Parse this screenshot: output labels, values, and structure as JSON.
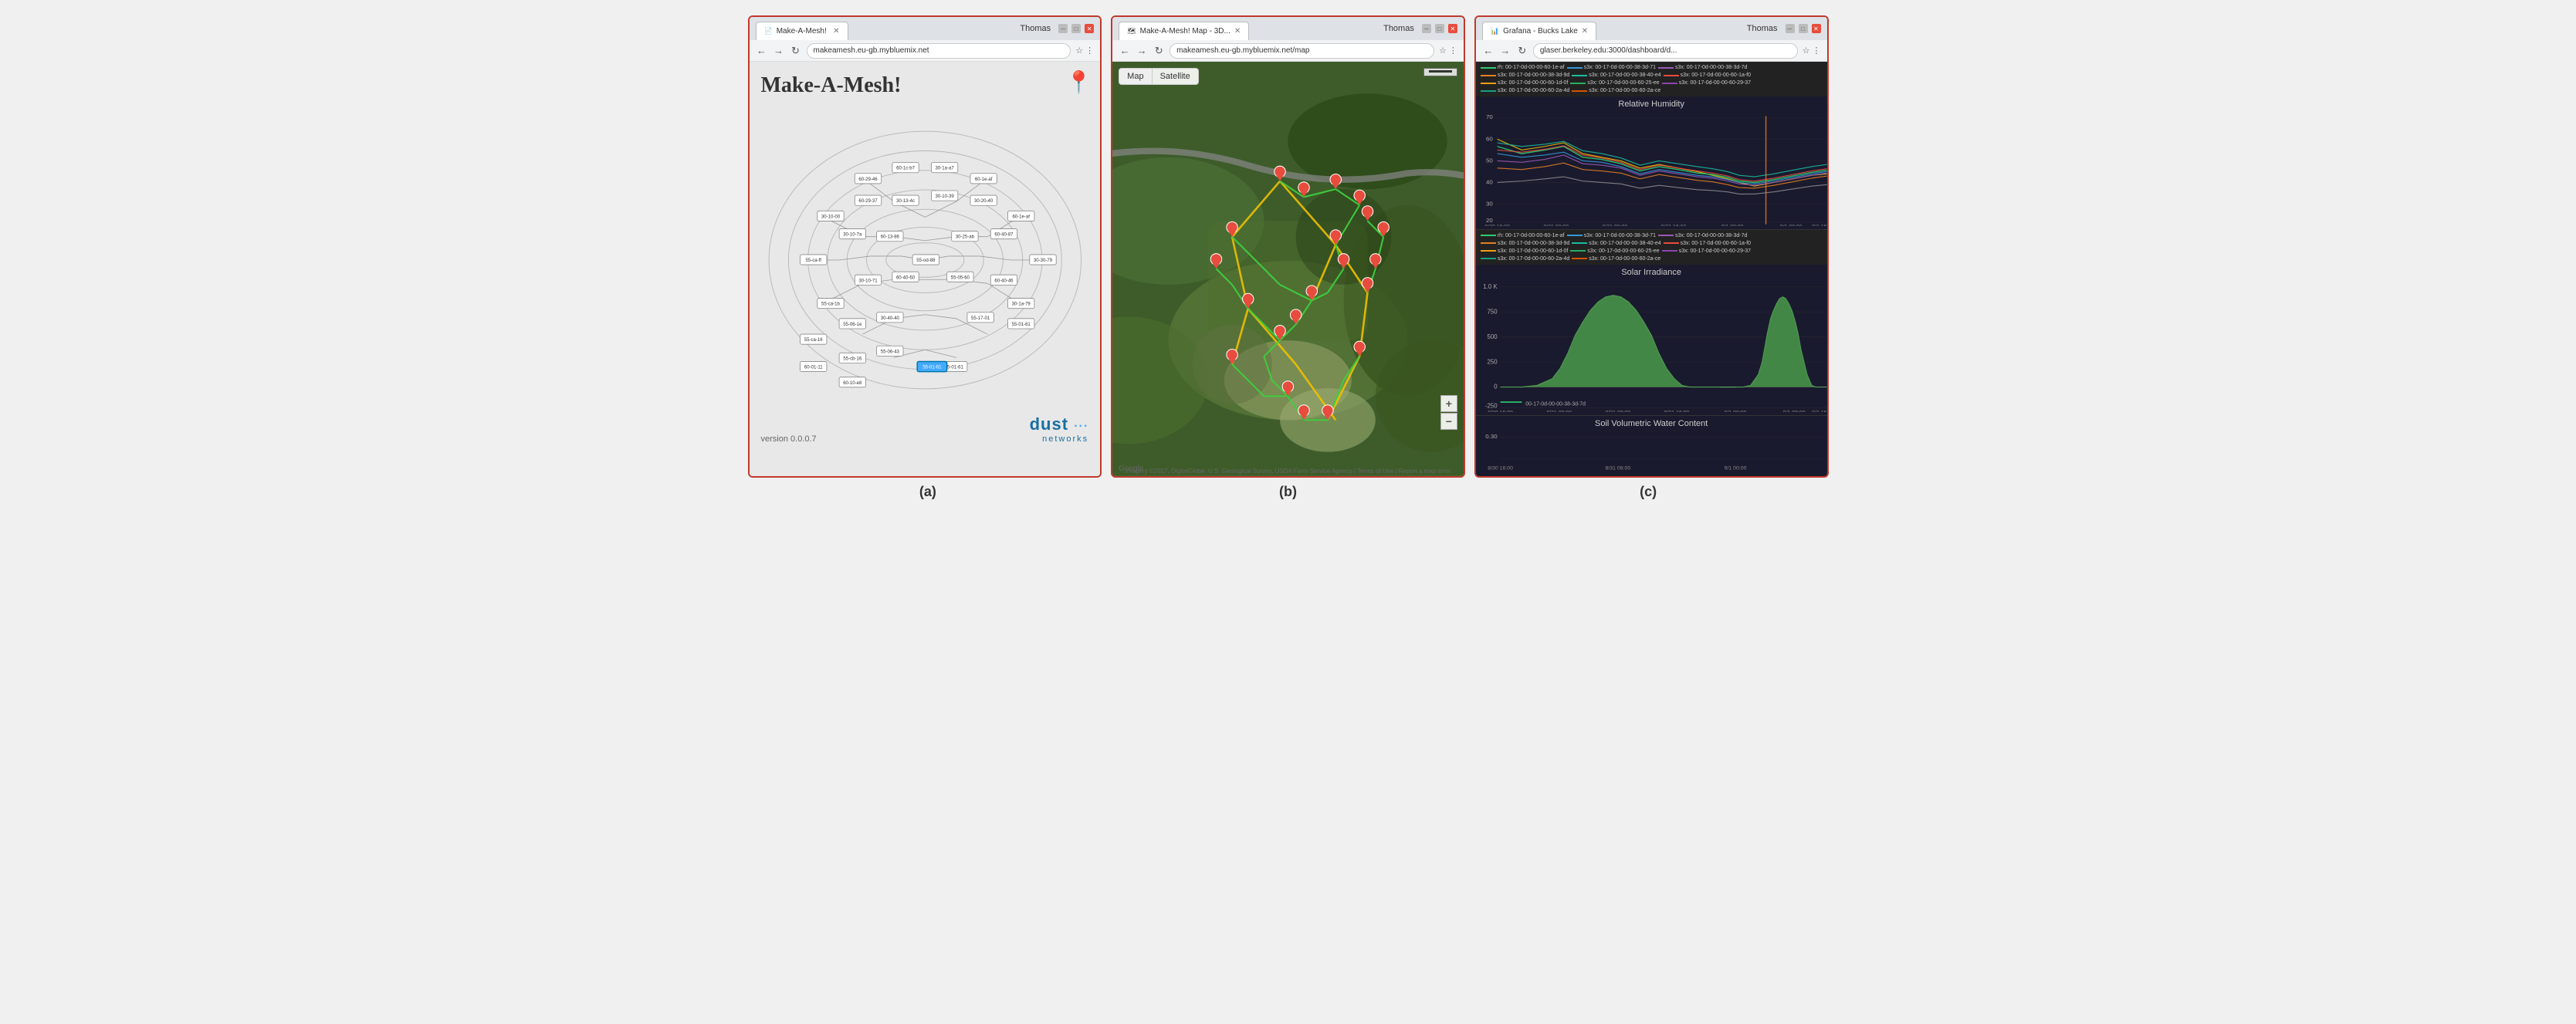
{
  "windows": [
    {
      "id": "window-a",
      "tab_title": "Make-A-Mesh!",
      "user": "Thomas",
      "url": "makeamesh.eu-gb.mybluemix.net",
      "content_type": "mesh",
      "title": "Make-A-Mesh!",
      "version": "version 0.0.0.7",
      "logo_main": "dust",
      "logo_sub": "networks",
      "caption": "(a)"
    },
    {
      "id": "window-b",
      "tab_title": "Make-A-Mesh! Map - 3D...",
      "user": "Thomas",
      "url": "makeamesh.eu-gb.mybluemix.net/map",
      "content_type": "map",
      "map_btn_map": "Map",
      "map_btn_satellite": "Satellite",
      "google_label": "Google",
      "attribution": "Imagery ©2017, DigitalGlobe, U.S. Geological Survey, USDA Farm Service Agency | Terms of Use | Report a map error",
      "caption": "(b)"
    },
    {
      "id": "window-c",
      "tab_title": "Grafana - Bucks Lake",
      "user": "Thomas",
      "url": "glaser.berkeley.edu:3000/dashboard/d...",
      "content_type": "grafana",
      "panel1_title": "Relative Humidity",
      "panel2_title": "Solar Irradiance",
      "panel3_title": "Soil Volumetric Water Content",
      "legend_items": [
        {
          "color": "#2ecc71",
          "label": "rh: 00-17-0d-00-00-60-1e-af"
        },
        {
          "color": "#3498db",
          "label": "s3x: 00-17-0d-00-00-38-3d-71"
        },
        {
          "color": "#9b59b6",
          "label": "s3x: 00-17-0d-00-00-38-3d-7d"
        },
        {
          "color": "#e67e22",
          "label": "s3x: 00-17-0d-00-00-38-3d-9d"
        },
        {
          "color": "#1abc9c",
          "label": "s3x: 00-17-0d-00-00-38-40-e4"
        },
        {
          "color": "#e74c3c",
          "label": "s3x: 00-17-0d-00-00-60-1a-f0"
        },
        {
          "color": "#f39c12",
          "label": "s3x: 00-17-0d-00-00-60-1d-0f"
        },
        {
          "color": "#27ae60",
          "label": "s3x: 00-17-0d-00-00-60-25-ee"
        },
        {
          "color": "#8e44ad",
          "label": "s3x: 00-17-0d-00-00-60-29-37"
        },
        {
          "color": "#16a085",
          "label": "s3x: 00-17-0d-00-00-60-2a-4d"
        },
        {
          "color": "#d35400",
          "label": "s3x: 00-17-0d-00-00-60-2a-ce"
        }
      ],
      "caption": "(c)"
    }
  ],
  "captions": [
    "(a)",
    "(b)",
    "(c)"
  ]
}
